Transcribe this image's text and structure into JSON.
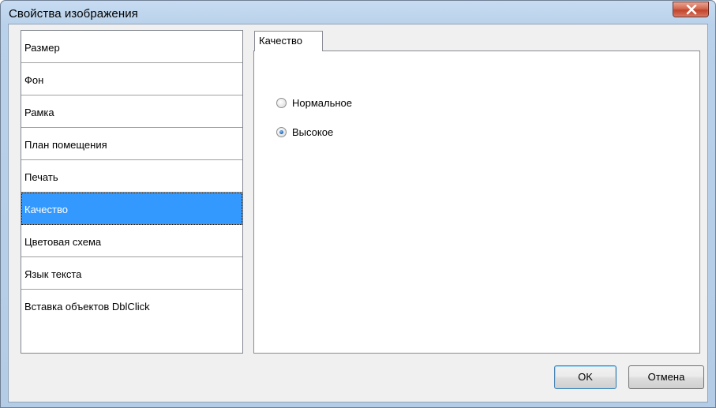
{
  "window": {
    "title": "Свойства изображения"
  },
  "nav": {
    "items": [
      {
        "label": "Размер"
      },
      {
        "label": "Фон"
      },
      {
        "label": "Рамка"
      },
      {
        "label": "План помещения"
      },
      {
        "label": "Печать"
      },
      {
        "label": "Качество",
        "selected": true
      },
      {
        "label": "Цветовая схема"
      },
      {
        "label": "Язык текста"
      },
      {
        "label": "Вставка объектов DblClick"
      }
    ]
  },
  "tab": {
    "label": "Качество"
  },
  "quality": {
    "options": [
      {
        "label": "Нормальное",
        "checked": false
      },
      {
        "label": "Высокое",
        "checked": true
      }
    ]
  },
  "buttons": {
    "ok_label": "OK",
    "cancel_label": "Отмена"
  },
  "colors": {
    "selection": "#3399ff",
    "close_button": "#c1442b"
  },
  "icons": {
    "close": "close-icon"
  }
}
